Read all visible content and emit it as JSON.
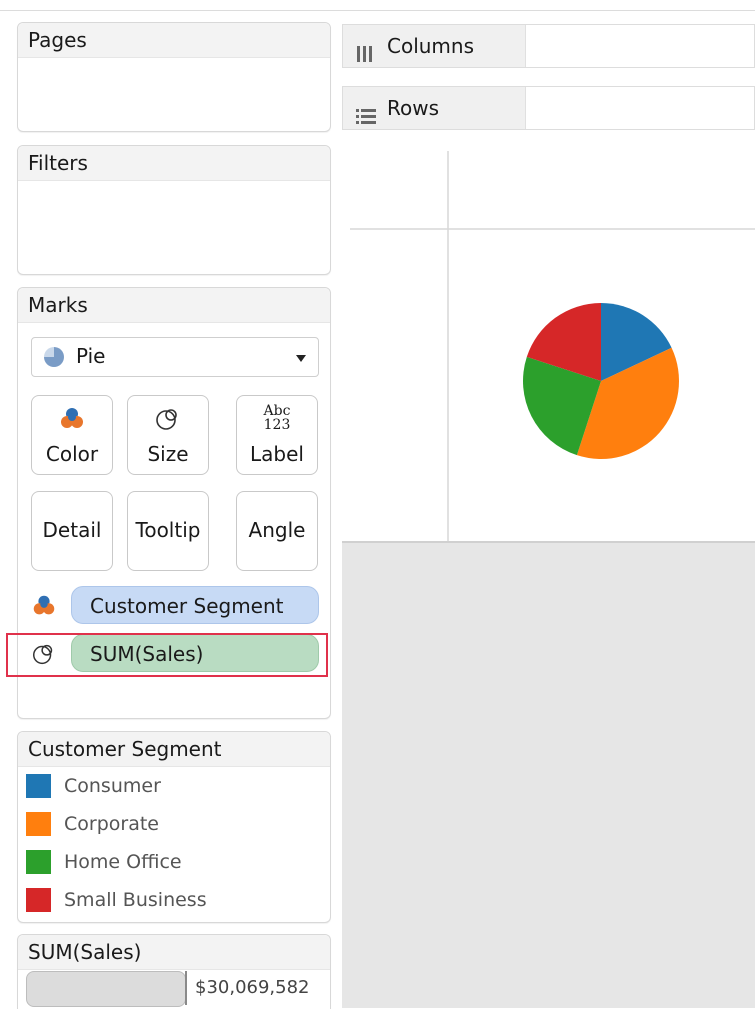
{
  "pages": {
    "title": "Pages"
  },
  "filters": {
    "title": "Filters"
  },
  "marks": {
    "title": "Marks",
    "mark_type": "Pie",
    "buttons": {
      "color": "Color",
      "size": "Size",
      "label": "Label",
      "label_glyph_top": "Abc",
      "label_glyph_bottom": "123",
      "detail": "Detail",
      "tooltip": "Tooltip",
      "angle": "Angle"
    },
    "pills": {
      "color_field": "Customer Segment",
      "size_field": "SUM(Sales)"
    }
  },
  "shelves": {
    "columns": "Columns",
    "rows": "Rows"
  },
  "color_legend": {
    "title": "Customer Segment",
    "items": [
      {
        "label": "Consumer",
        "color": "#1f77b4"
      },
      {
        "label": "Corporate",
        "color": "#ff7f0e"
      },
      {
        "label": "Home Office",
        "color": "#2ca02c"
      },
      {
        "label": "Small Business",
        "color": "#d62728"
      }
    ]
  },
  "size_legend": {
    "title": "SUM(Sales)",
    "max_value": "$30,069,582"
  },
  "chart_data": {
    "type": "pie",
    "categories": [
      "Consumer",
      "Corporate",
      "Home Office",
      "Small Business"
    ],
    "values": [
      18,
      37,
      25,
      20
    ],
    "colors": [
      "#1f77b4",
      "#ff7f0e",
      "#2ca02c",
      "#d62728"
    ]
  }
}
